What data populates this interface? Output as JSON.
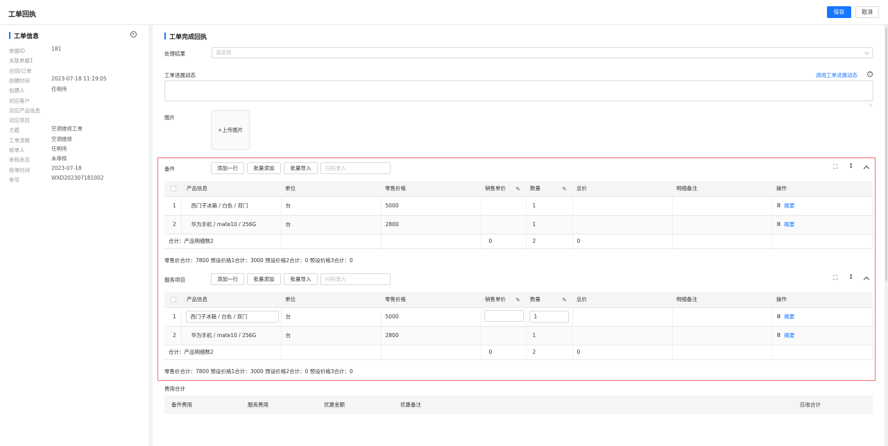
{
  "header": {
    "title": "工单回执",
    "save_label": "保存",
    "cancel_label": "取消"
  },
  "left_panel": {
    "title": "工单信息",
    "fields": [
      {
        "label": "单据ID",
        "value": "181"
      },
      {
        "label": "关联单据1",
        "value": ""
      },
      {
        "label": "合同/订单",
        "value": ""
      },
      {
        "label": "创建时间",
        "value": "2023-07-18 11:19:05"
      },
      {
        "label": "创建人",
        "value": "任明伟"
      },
      {
        "label": "对应客户",
        "value": ""
      },
      {
        "label": "对应产品信息",
        "value": ""
      },
      {
        "label": "对应项目",
        "value": ""
      },
      {
        "label": "主题",
        "value": "空调维修工单"
      },
      {
        "label": "工单流程",
        "value": "空调维修"
      },
      {
        "label": "收单人",
        "value": "任明伟"
      },
      {
        "label": "审核状态",
        "value": "未审核"
      },
      {
        "label": "收单时间",
        "value": "2023-07-18"
      },
      {
        "label": "单号",
        "value": "WXD202307181002"
      }
    ]
  },
  "form": {
    "title": "工单完成回执",
    "result_label": "处理结果",
    "result_placeholder": "请选择",
    "progress_label": "工单进展动态",
    "progress_link": "调用工单进展动态",
    "progress_count": "0",
    "image_label": "图片",
    "upload_label": "+上传图片"
  },
  "toolbar": {
    "add_row": "添加一行",
    "batch_add": "批量添加",
    "batch_import": "批量导入",
    "scan_placeholder": "扫码录入"
  },
  "columns": [
    "产品信息",
    "单位",
    "零售价格",
    "销售单价",
    "数量",
    "总价",
    "明细备注",
    "操作"
  ],
  "parts": {
    "title": "备件",
    "rows": [
      {
        "no": "1",
        "product": "西门子冰箱 / 白色 / 双门",
        "unit": "台",
        "price": "5000",
        "sale_price": "",
        "qty": "1",
        "total": "",
        "note": "",
        "op": "概要"
      },
      {
        "no": "2",
        "product": "华为手机 / mate10 / 256G",
        "unit": "台",
        "price": "2800",
        "sale_price": "",
        "qty": "1",
        "total": "",
        "note": "",
        "op": "概要"
      }
    ],
    "sum_label": "合计：产品明细数2",
    "sum_sale": "0",
    "sum_qty": "2",
    "sum_total": "0",
    "summary": "零售价合计：7800  预设价格1合计：3000  预设价格2合计：0  预设价格3合计：0"
  },
  "services": {
    "title": "服务项目",
    "rows": [
      {
        "no": "1",
        "product": "西门子冰箱 / 白色 / 双门",
        "unit": "台",
        "price": "5000",
        "sale_price": "",
        "qty": "1",
        "total": "",
        "note": "",
        "op": "概要"
      },
      {
        "no": "2",
        "product": "华为手机 / mate10 / 256G",
        "unit": "台",
        "price": "2800",
        "sale_price": "",
        "qty": "1",
        "total": "",
        "note": "",
        "op": "概要"
      }
    ],
    "sum_label": "合计：产品明细数2",
    "sum_sale": "0",
    "sum_qty": "2",
    "sum_total": "0",
    "summary": "零售价合计：7800  预设价格1合计：3000  预设价格2合计：0  预设价格3合计：0"
  },
  "fees": {
    "title": "费用合计",
    "columns": [
      "备件费用",
      "服务费用",
      "优惠金额",
      "优惠备注",
      "应收合计"
    ]
  },
  "icons": {
    "settings": "gear-icon",
    "fullscreen": "expand-icon",
    "height": "resize-vertical-icon",
    "collapse": "chevron-up-icon",
    "edit": "pencil-icon",
    "drag": "drag-handle-icon",
    "help": "question-icon"
  },
  "colors": {
    "primary": "#1677ff",
    "highlight_border": "#f0656a"
  }
}
